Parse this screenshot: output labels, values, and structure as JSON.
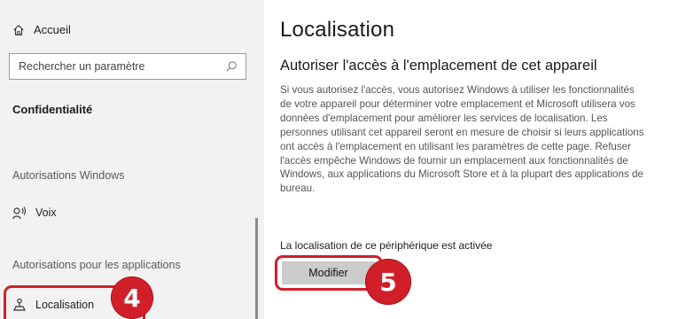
{
  "sidebar": {
    "home_label": "Accueil",
    "search_placeholder": "Rechercher un paramètre",
    "section_heading": "Confidentialité",
    "group_windows": "Autorisations Windows",
    "voice_label": "Voix",
    "group_apps": "Autorisations pour les applications",
    "location_label": "Localisation"
  },
  "main": {
    "title": "Localisation",
    "subtitle": "Autoriser l'accès à l'emplacement de cet appareil",
    "description": "Si vous autorisez l'accès, vous autorisez Windows à utiliser les fonctionnalités de votre appareil pour déterminer votre emplacement et Microsoft utilisera vos données d'emplacement pour améliorer les services de localisation. Les personnes utilisant cet appareil seront en mesure de choisir si leurs applications ont accès à l'emplacement en utilisant les paramètres de cette page. Refuser l'accès empêche Windows de fournir un emplacement aux fonctionnalités de Windows, aux applications du Microsoft Store et à la plupart des applications de bureau.",
    "status": "La localisation de ce périphérique est activée",
    "modify_label": "Modifier"
  },
  "annotations": {
    "step_4": "4",
    "step_5": "5"
  },
  "colors": {
    "highlight": "#d11f2a",
    "sidebar_bg": "#f2f2f2",
    "button_bg": "#cccccc"
  },
  "icons": {
    "home": "home-icon",
    "search": "search-icon",
    "voice": "voice-icon",
    "location": "location-icon"
  }
}
